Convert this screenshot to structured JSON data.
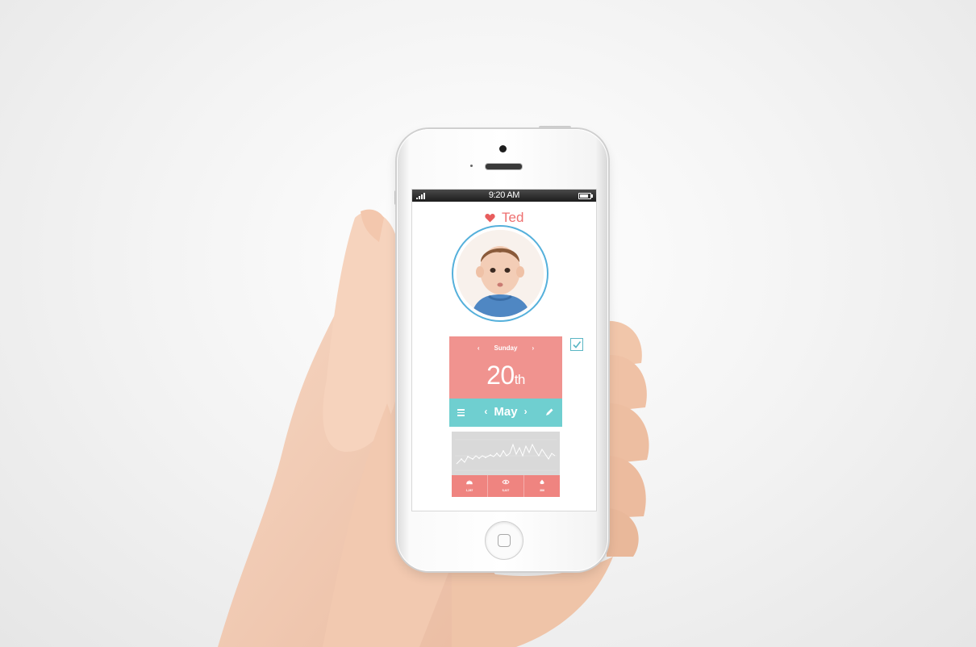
{
  "status_bar": {
    "time": "9:20 AM"
  },
  "profile": {
    "name": "Ted"
  },
  "date_card": {
    "day_label": "Sunday",
    "prev_day_icon": "chevron-left-icon",
    "next_day_icon": "chevron-right-icon",
    "date_number": "20",
    "date_suffix": "th",
    "month_label": "May",
    "prev_month_symbol": "‹",
    "next_month_symbol": "›",
    "left_icon": "menu-icon",
    "right_icon": "pencil-icon"
  },
  "checkbox": {
    "checked": true
  },
  "colors": {
    "accent_red": "#ee7070",
    "card_coral": "#f0938f",
    "card_teal": "#6fcfd0",
    "avatar_ring": "#55b0db",
    "stats_red": "#ef8480"
  },
  "stats": [
    {
      "icon": "lungs-icon",
      "value": "1,287"
    },
    {
      "icon": "eye-icon",
      "value": "5,427"
    },
    {
      "icon": "drop-icon",
      "value": "386"
    }
  ]
}
